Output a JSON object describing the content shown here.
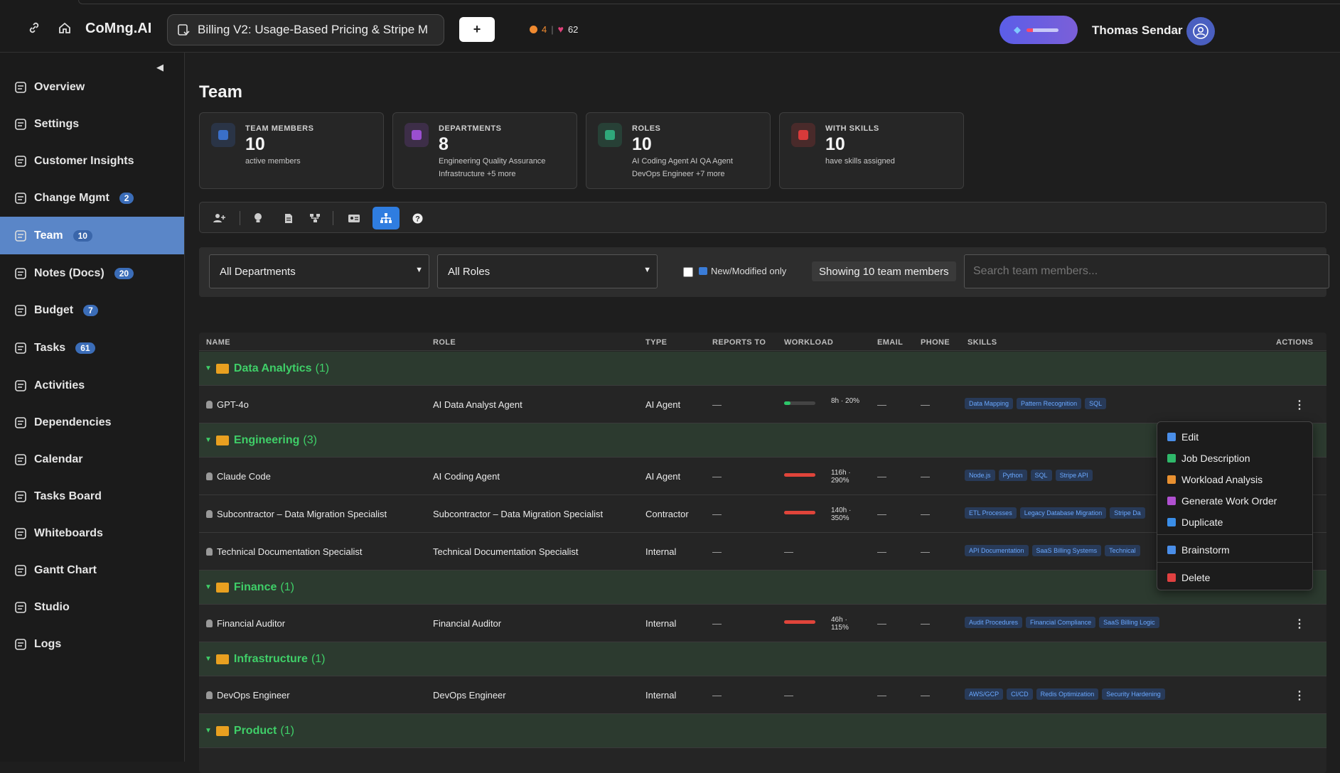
{
  "header": {
    "brand": "CoMng.AI",
    "project": "Billing V2: Usage-Based Pricing & Stripe M",
    "add_label": "+",
    "stat_orange": "4",
    "stat_separator": "|",
    "stat_hearts": "62",
    "user_name": "Thomas Sendar"
  },
  "sidebar": {
    "items": [
      {
        "label": "Overview",
        "icon": "overview-icon"
      },
      {
        "label": "Settings",
        "icon": "settings-icon"
      },
      {
        "label": "Customer Insights",
        "icon": "lightbulb-icon"
      },
      {
        "label": "Change Mgmt",
        "icon": "change-icon",
        "badge": "2"
      },
      {
        "label": "Team",
        "icon": "team-icon",
        "badge": "10"
      },
      {
        "label": "Notes (Docs)",
        "icon": "notes-icon",
        "badge": "20"
      },
      {
        "label": "Budget",
        "icon": "budget-icon",
        "badge": "7"
      },
      {
        "label": "Tasks",
        "icon": "tasks-icon",
        "badge": "61"
      },
      {
        "label": "Activities",
        "icon": "activities-icon"
      },
      {
        "label": "Dependencies",
        "icon": "dependencies-icon"
      },
      {
        "label": "Calendar",
        "icon": "calendar-icon"
      },
      {
        "label": "Tasks Board",
        "icon": "board-icon"
      },
      {
        "label": "Whiteboards",
        "icon": "whiteboard-icon"
      },
      {
        "label": "Gantt Chart",
        "icon": "gantt-icon"
      },
      {
        "label": "Studio",
        "icon": "studio-icon"
      },
      {
        "label": "Logs",
        "icon": "logs-icon"
      }
    ]
  },
  "page": {
    "title": "Team"
  },
  "cards": [
    {
      "label": "TEAM MEMBERS",
      "value": "10",
      "sub1": "active members",
      "sub2": "",
      "color": "#3a6fc8"
    },
    {
      "label": "DEPARTMENTS",
      "value": "8",
      "sub1": "Engineering  Quality Assurance",
      "sub2": "Infrastructure  +5 more",
      "color": "#9a4fd0"
    },
    {
      "label": "ROLES",
      "value": "10",
      "sub1": "AI Coding Agent  AI QA Agent",
      "sub2": "DevOps Engineer  +7 more",
      "color": "#2fa87a"
    },
    {
      "label": "WITH SKILLS",
      "value": "10",
      "sub1": "have skills assigned",
      "sub2": "",
      "color": "#d83a3a"
    }
  ],
  "filters": {
    "department": "All Departments",
    "role": "All Roles",
    "new_modified": "New/Modified only",
    "showing": "Showing 10 team members",
    "search_placeholder": "Search team members..."
  },
  "table": {
    "headers": {
      "name": "NAME",
      "role": "ROLE",
      "type": "TYPE",
      "reports_to": "REPORTS TO",
      "workload": "WORKLOAD",
      "email": "EMAIL",
      "phone": "PHONE",
      "skills": "SKILLS",
      "actions": "ACTIONS"
    },
    "dash": "—",
    "groups": {
      "data_analytics": {
        "name": "Data Analytics",
        "count": "(1)"
      },
      "engineering": {
        "name": "Engineering",
        "count": "(3)"
      },
      "finance": {
        "name": "Finance",
        "count": "(1)"
      },
      "infrastructure": {
        "name": "Infrastructure",
        "count": "(1)"
      },
      "product": {
        "name": "Product",
        "count": "(1)"
      }
    },
    "rows": [
      {
        "name": "GPT-4o",
        "role": "AI Data Analyst Agent",
        "type": "AI Agent",
        "workload": "8h · 20%",
        "workload_pct": 20,
        "workload_color": "#2ec76a",
        "skills": [
          "Data Mapping",
          "Pattern Recognition",
          "SQL"
        ]
      },
      {
        "name": "Claude Code",
        "role": "AI Coding Agent",
        "type": "AI Agent",
        "workload": "116h · 290%",
        "workload_pct": 100,
        "workload_color": "#e0443a",
        "skills": [
          "Node.js",
          "Python",
          "SQL",
          "Stripe API"
        ]
      },
      {
        "name": "Subcontractor – Data Migration Specialist",
        "role": "Subcontractor – Data Migration Specialist",
        "type": "Contractor",
        "workload": "140h · 350%",
        "workload_pct": 100,
        "workload_color": "#e0443a",
        "skills": [
          "ETL Processes",
          "Legacy Database Migration",
          "Stripe Da"
        ]
      },
      {
        "name": "Technical Documentation Specialist",
        "role": "Technical Documentation Specialist",
        "type": "Internal",
        "workload": "",
        "workload_pct": 0,
        "workload_color": "",
        "skills": [
          "API Documentation",
          "SaaS Billing Systems",
          "Technical"
        ]
      },
      {
        "name": "Financial Auditor",
        "role": "Financial Auditor",
        "type": "Internal",
        "workload": "46h · 115%",
        "workload_pct": 100,
        "workload_color": "#e0443a",
        "skills": [
          "Audit Procedures",
          "Financial Compliance",
          "SaaS Billing Logic"
        ]
      },
      {
        "name": "DevOps Engineer",
        "role": "DevOps Engineer",
        "type": "Internal",
        "workload": "",
        "workload_pct": 0,
        "workload_color": "",
        "skills": [
          "AWS/GCP",
          "CI/CD",
          "Redis Optimization",
          "Security Hardening"
        ]
      }
    ]
  },
  "context_menu": {
    "items": [
      {
        "label": "Edit",
        "color": "#4a8ee8"
      },
      {
        "label": "Job Description",
        "color": "#2fb86a"
      },
      {
        "label": "Workload Analysis",
        "color": "#e89030"
      },
      {
        "label": "Generate Work Order",
        "color": "#b050d0"
      },
      {
        "label": "Duplicate",
        "color": "#3a8ee8"
      },
      {
        "label": "Brainstorm",
        "color": "#4a8ee8"
      },
      {
        "label": "Delete",
        "color": "#e04040"
      }
    ]
  }
}
